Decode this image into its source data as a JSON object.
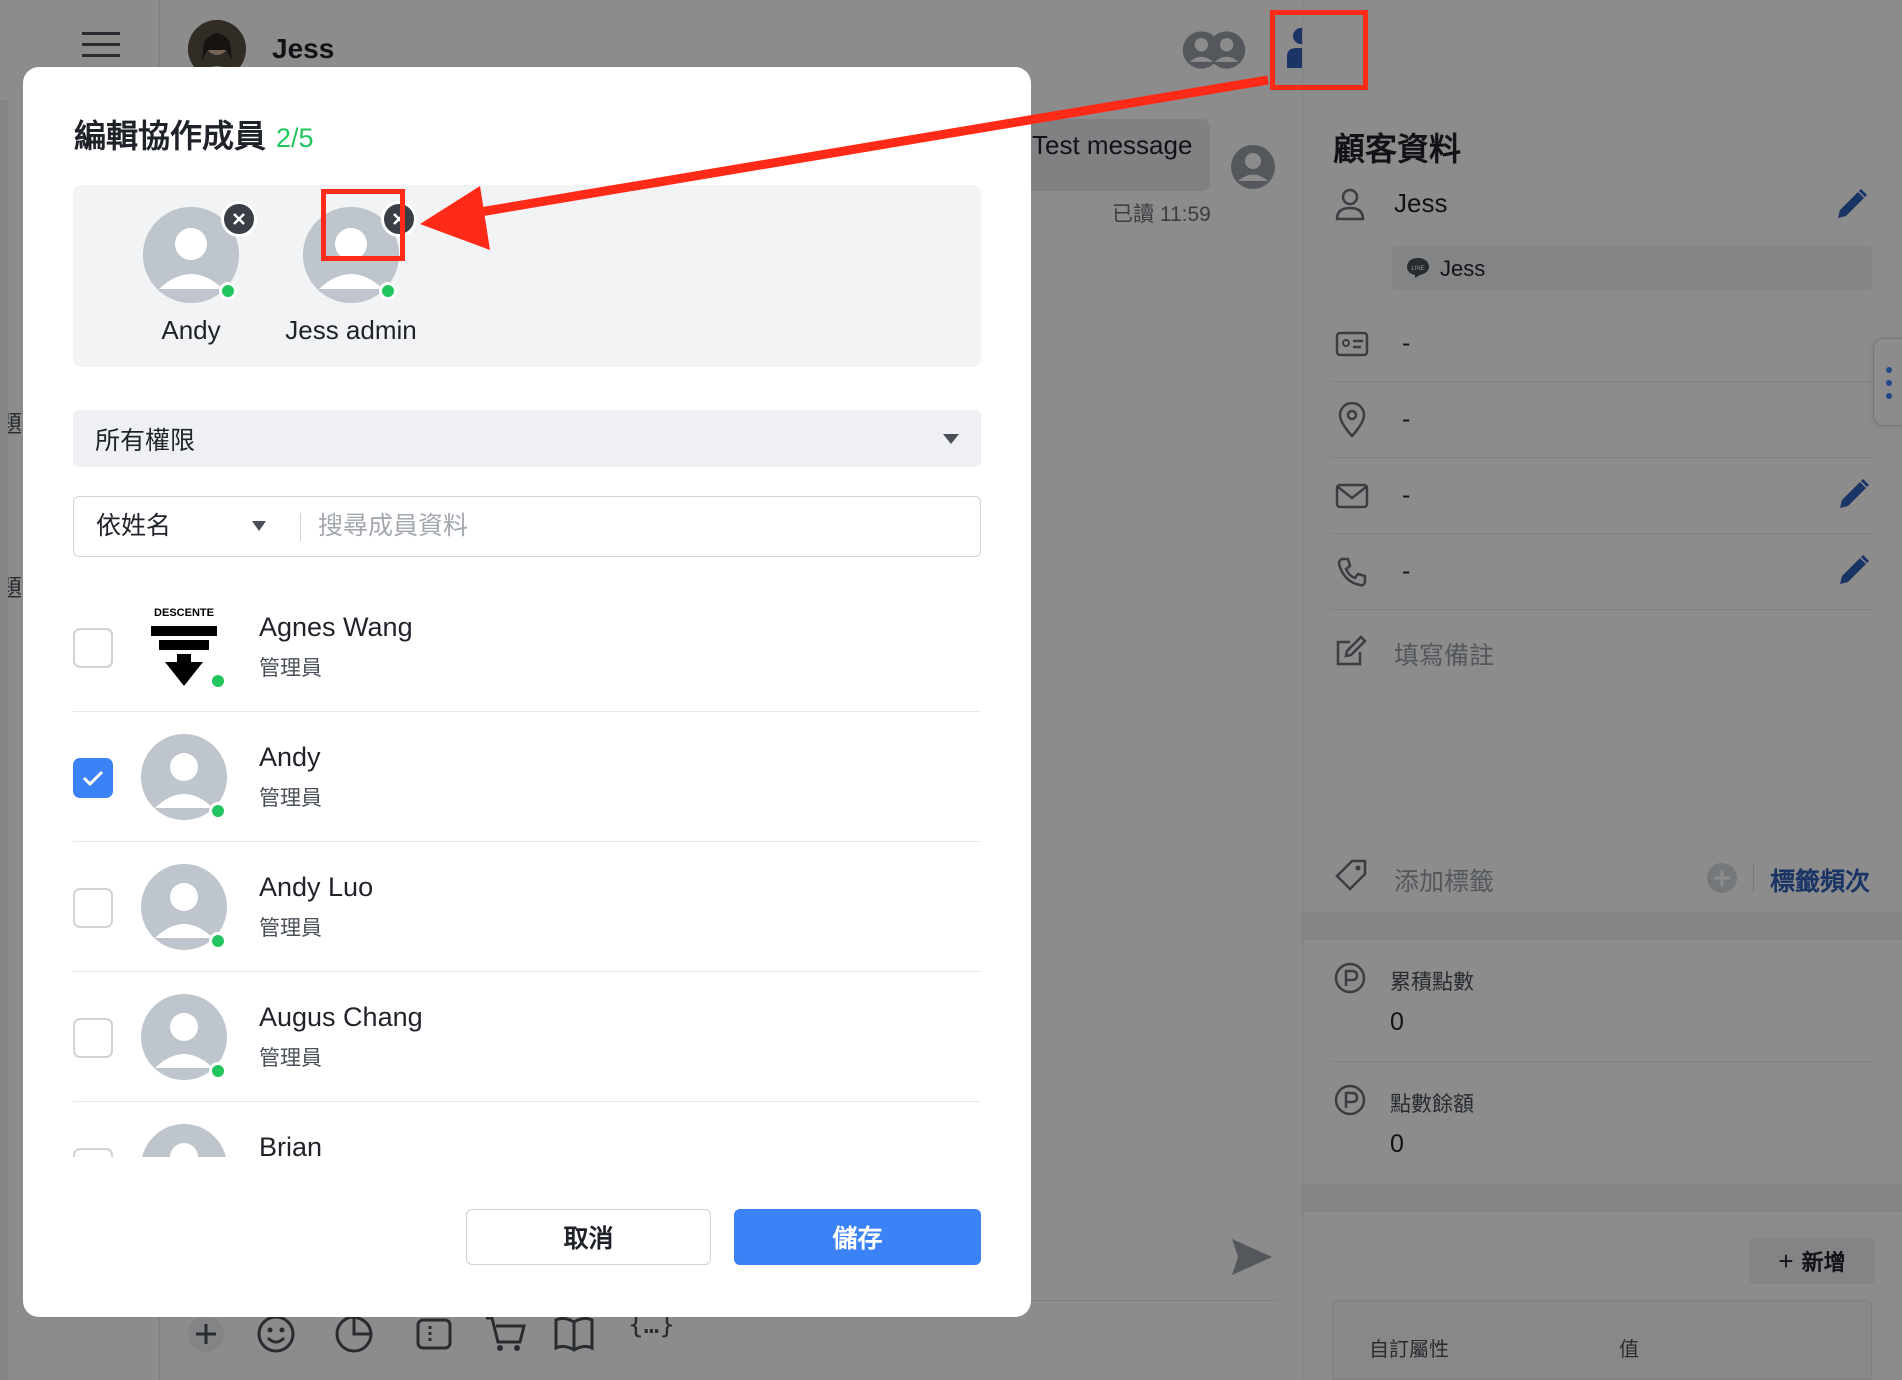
{
  "header": {
    "contact_name": "Jess"
  },
  "chat": {
    "message_text": "Test message",
    "read_receipt": "已讀 11:59"
  },
  "customer_panel": {
    "title": "顧客資料",
    "name": "Jess",
    "line_name": "Jess",
    "id_value": "-",
    "location_value": "-",
    "email_value": "-",
    "phone_value": "-",
    "note_placeholder": "填寫備註",
    "add_tag_label": "添加標籤",
    "tag_frequency_link": "標籤頻次",
    "accumulated_points_label": "累積點數",
    "accumulated_points_value": "0",
    "points_balance_label": "點數餘額",
    "points_balance_value": "0",
    "add_button_label": "新增",
    "custom_attr_header": "自訂屬性",
    "value_header": "值",
    "left_fragment_1": "題",
    "left_fragment_2": "題"
  },
  "modal": {
    "title": "編輯協作成員",
    "count": "2/5",
    "selected_members": [
      {
        "name": "Andy"
      },
      {
        "name": "Jess admin"
      }
    ],
    "permission_filter": "所有權限",
    "search_by": "依姓名",
    "search_placeholder": "搜尋成員資料",
    "members": [
      {
        "name": "Agnes Wang",
        "role": "管理員",
        "checked": false,
        "avatar": "descente-logo",
        "logo_text": "DESCENTE"
      },
      {
        "name": "Andy",
        "role": "管理員",
        "checked": true,
        "avatar": "default-user"
      },
      {
        "name": "Andy Luo",
        "role": "管理員",
        "checked": false,
        "avatar": "default-user"
      },
      {
        "name": "Augus Chang",
        "role": "管理員",
        "checked": false,
        "avatar": "default-user"
      },
      {
        "name": "Brian",
        "role": "",
        "checked": false,
        "avatar": "default-user"
      }
    ],
    "cancel_label": "取消",
    "save_label": "儲存"
  },
  "colors": {
    "accent_blue": "#3b82f6",
    "icon_blue": "#2f5fb8",
    "online_green": "#22c55e",
    "annotation_red": "#ff2a17",
    "count_green": "#22c55e"
  },
  "icons": {
    "top_bar": [
      "group-avatar-icon",
      "add-collaborator-icon",
      "user-avatar-icon",
      "pin-icon",
      "exit-icon",
      "history-icon",
      "eye-icon",
      "settings-sliders-icon"
    ]
  }
}
